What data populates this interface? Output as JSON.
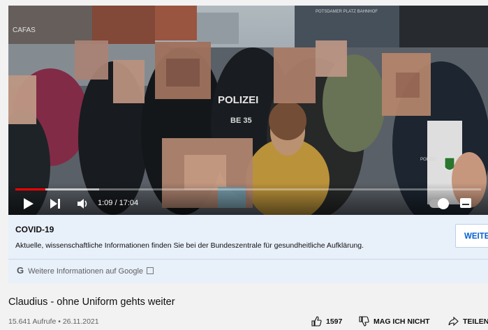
{
  "player": {
    "time_display": "1:09 / 17:04",
    "progress_fraction": 0.065,
    "buffer_fraction": 0.18,
    "scene_text": {
      "sign_top": "CAFAS",
      "police_text": "POLIZEI",
      "police_code": "BE 35",
      "station_sign": "POTSDAMER PLATZ  BAHNHOF",
      "patch_text": "POLIZEI"
    },
    "icons": {
      "play": "play-icon",
      "next": "next-icon",
      "volume": "volume-icon",
      "autoplay": "autoplay-toggle-icon",
      "subtitles": "subtitles-icon"
    },
    "accent": "#ff0000"
  },
  "info_panel": {
    "title": "COVID-19",
    "text": "Aktuelle, wissenschaftliche Informationen finden Sie bei der Bundeszentrale für gesundheitliche Aufklärung.",
    "button_label": "WEITER",
    "google_label": "Weitere Informationen auf Google",
    "google_glyph": "G",
    "background": "#e8f0fa"
  },
  "video": {
    "title": "Claudius - ohne Uniform gehts weiter",
    "meta": "15.641 Aufrufe • 26.11.2021",
    "likes": "1597",
    "dislike_label": "MAG ICH NICHT",
    "share_label": "TEILEN"
  }
}
